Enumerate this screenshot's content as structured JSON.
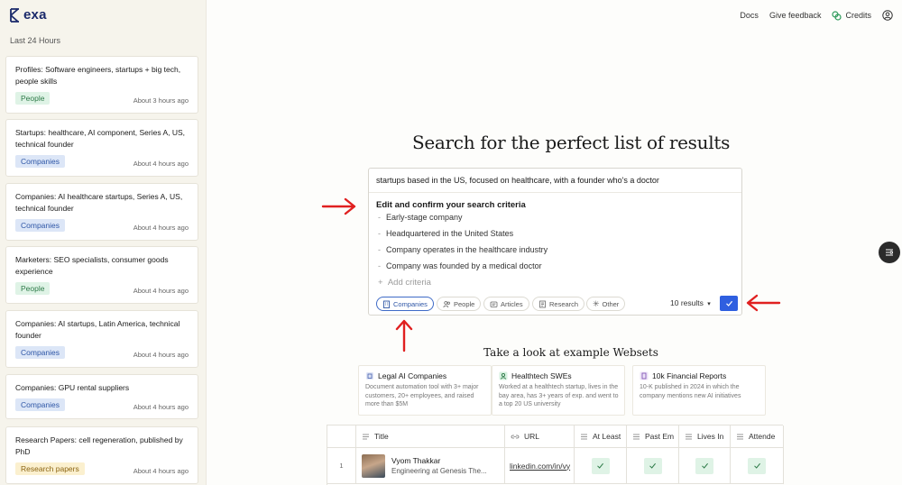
{
  "app": {
    "logo_text": "exa"
  },
  "sidebar": {
    "section_title": "Last 24 Hours",
    "items": [
      {
        "title": "Profiles: Software engineers, startups + big tech, people skills",
        "tag": "People",
        "time": "About 3 hours ago"
      },
      {
        "title": "Startups: healthcare, AI component, Series A, US, technical founder",
        "tag": "Companies",
        "time": "About 4 hours ago"
      },
      {
        "title": "Companies: AI healthcare startups, Series A, US, technical founder",
        "tag": "Companies",
        "time": "About 4 hours ago"
      },
      {
        "title": "Marketers: SEO specialists, consumer goods experience",
        "tag": "People",
        "time": "About 4 hours ago"
      },
      {
        "title": "Companies: AI startups, Latin America, technical founder",
        "tag": "Companies",
        "time": "About 4 hours ago"
      },
      {
        "title": "Companies: GPU rental suppliers",
        "tag": "Companies",
        "time": "About 4 hours ago"
      },
      {
        "title": "Research Papers: cell regeneration, published by PhD",
        "tag": "Research papers",
        "time": "About 4 hours ago"
      }
    ]
  },
  "topnav": {
    "docs": "Docs",
    "feedback": "Give feedback",
    "credits": "Credits"
  },
  "main": {
    "headline": "Search for the perfect list of results",
    "query": "startups based in the US, focused on healthcare, with a founder who's a doctor",
    "criteria_title": "Edit and confirm your search criteria",
    "criteria": [
      "Early-stage company",
      "Headquartered in the United States",
      "Company operates in the healthcare industry",
      "Company was founded by a medical doctor"
    ],
    "add_criteria": "Add criteria",
    "entity_types": [
      {
        "label": "Companies",
        "icon": "building-icon",
        "selected": true
      },
      {
        "label": "People",
        "icon": "people-icon",
        "selected": false
      },
      {
        "label": "Articles",
        "icon": "articles-icon",
        "selected": false
      },
      {
        "label": "Research",
        "icon": "research-icon",
        "selected": false
      },
      {
        "label": "Other",
        "icon": "asterisk-icon",
        "selected": false
      }
    ],
    "results_count": "10 results"
  },
  "examples": {
    "title": "Take a look at example Websets",
    "cards": [
      {
        "title": "Legal AI Companies",
        "desc": "Document automation tool with 3+ major customers, 20+ employees, and raised more than $5M"
      },
      {
        "title": "Healthtech SWEs",
        "desc": "Worked at a healthtech startup, lives in the bay area, has 3+ years of exp. and went to a top 20 US university"
      },
      {
        "title": "10k Financial Reports",
        "desc": "10-K published in 2024 in which the company mentions new AI initiatives"
      }
    ]
  },
  "table": {
    "headers": [
      "Title",
      "URL",
      "At Least",
      "Past Em",
      "Lives In",
      "Attende"
    ],
    "rows": [
      {
        "num": "1",
        "name": "Vyom Thakkar",
        "subtitle": "Engineering at Genesis The...",
        "url": "linkedin.com/in/vy"
      }
    ]
  },
  "colors": {
    "accent": "#2f5fe0",
    "annotation_arrow": "#e02020"
  }
}
